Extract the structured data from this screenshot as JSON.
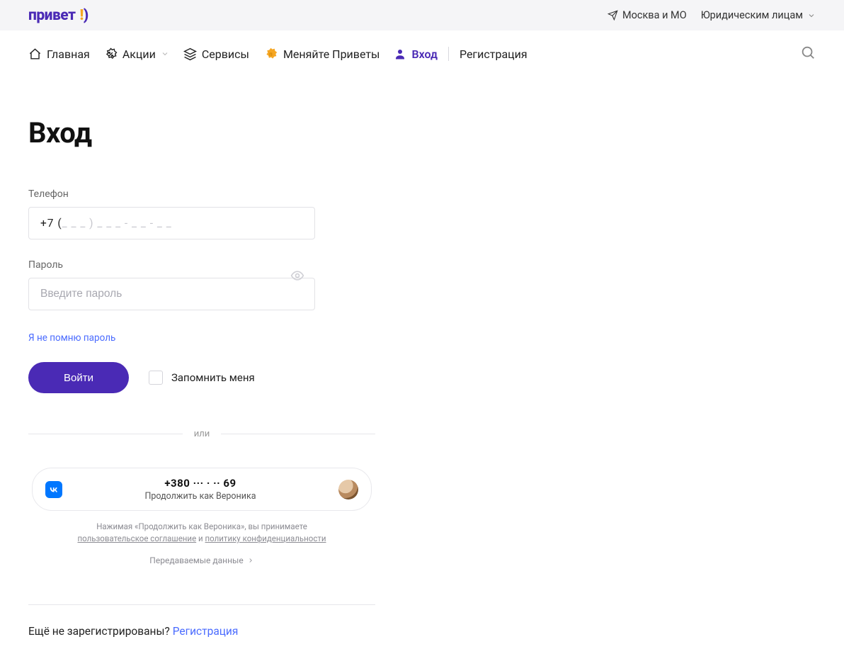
{
  "topbar": {
    "logo_text": "привет",
    "location": "Москва и МО",
    "business": "Юридическим лицам"
  },
  "nav": {
    "home": "Главная",
    "promo": "Акции",
    "services": "Сервисы",
    "exchange": "Меняйте Приветы",
    "login": "Вход",
    "register": "Регистрация"
  },
  "page": {
    "title": "Вход"
  },
  "form": {
    "phone_label": "Телефон",
    "phone_prefix": "+7 (",
    "phone_mask_rest": " _  _  _  )  _  _  _  -  _  _  -  _  _",
    "password_label": "Пароль",
    "password_placeholder": "Введите пароль",
    "forgot": "Я не помню пароль",
    "submit": "Войти",
    "remember": "Запомнить меня"
  },
  "or": "или",
  "vk": {
    "phone": "+380 ··· · ·· 69",
    "sub": "Продолжить как Вероника",
    "legal_pre": "Нажимая «Продолжить как Вероника», вы принимаете",
    "legal_tos": "пользовательское соглашение",
    "legal_and": "и",
    "legal_privacy": "политику конфиденциальности",
    "pass_data": "Передаваемые данные"
  },
  "bottom": {
    "prompt": "Ещё не зарегистрированы?",
    "link": "Регистрация"
  }
}
